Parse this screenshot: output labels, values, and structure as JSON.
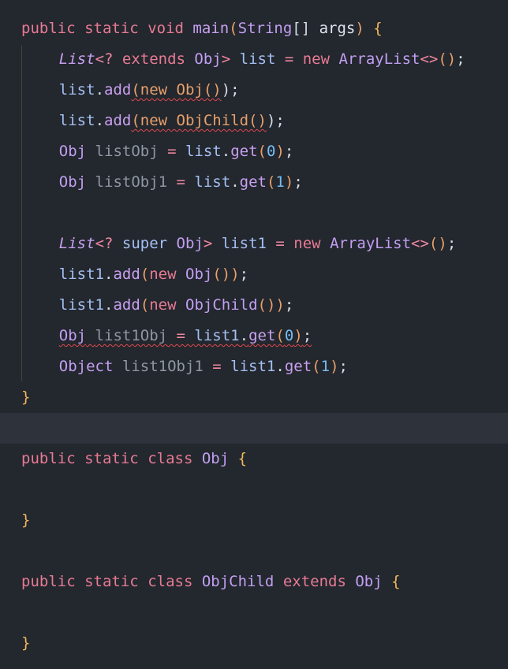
{
  "lines": [
    {
      "id": "main-signature",
      "indent": 0,
      "tokens": [
        {
          "t": "public",
          "c": "kw"
        },
        {
          "t": " ",
          "c": "pun"
        },
        {
          "t": "static",
          "c": "kw"
        },
        {
          "t": " ",
          "c": "pun"
        },
        {
          "t": "void",
          "c": "kw"
        },
        {
          "t": " ",
          "c": "pun"
        },
        {
          "t": "main",
          "c": "fn"
        },
        {
          "t": "(",
          "c": "par"
        },
        {
          "t": "String",
          "c": "ty"
        },
        {
          "t": "[]",
          "c": "pun"
        },
        {
          "t": " ",
          "c": "pun"
        },
        {
          "t": "args",
          "c": "arg"
        },
        {
          "t": ")",
          "c": "par"
        },
        {
          "t": " ",
          "c": "pun"
        },
        {
          "t": "{",
          "c": "br"
        }
      ]
    },
    {
      "id": "extends-list-declaration",
      "indent": 4,
      "tokens": [
        {
          "t": "List",
          "c": "fni"
        },
        {
          "t": "<? ",
          "c": "op"
        },
        {
          "t": "extends",
          "c": "kw"
        },
        {
          "t": " ",
          "c": "pun"
        },
        {
          "t": "Obj",
          "c": "ty"
        },
        {
          "t": "> ",
          "c": "op"
        },
        {
          "t": "list",
          "c": "var"
        },
        {
          "t": " = ",
          "c": "op"
        },
        {
          "t": "new",
          "c": "kw"
        },
        {
          "t": " ",
          "c": "pun"
        },
        {
          "t": "ArrayList",
          "c": "ty"
        },
        {
          "t": "<>",
          "c": "op"
        },
        {
          "t": "()",
          "c": "par"
        },
        {
          "t": ";",
          "c": "pun"
        }
      ]
    },
    {
      "id": "list-add-obj",
      "indent": 4,
      "tokens": [
        {
          "t": "list",
          "c": "var"
        },
        {
          "t": ".",
          "c": "pun"
        },
        {
          "t": "add",
          "c": "fn"
        },
        {
          "t": "(new Obj()",
          "c": "par",
          "err": true
        },
        {
          "t": ");",
          "c": "pun"
        }
      ]
    },
    {
      "id": "list-add-objchild",
      "indent": 4,
      "tokens": [
        {
          "t": "list",
          "c": "var"
        },
        {
          "t": ".",
          "c": "pun"
        },
        {
          "t": "add",
          "c": "fn"
        },
        {
          "t": "(new ObjChild()",
          "c": "par",
          "err": true
        },
        {
          "t": ");",
          "c": "pun"
        }
      ]
    },
    {
      "id": "list-get-0",
      "indent": 4,
      "tokens": [
        {
          "t": "Obj",
          "c": "ty"
        },
        {
          "t": " ",
          "c": "pun"
        },
        {
          "t": "listObj",
          "c": "unused"
        },
        {
          "t": " = ",
          "c": "op"
        },
        {
          "t": "list",
          "c": "var"
        },
        {
          "t": ".",
          "c": "pun"
        },
        {
          "t": "get",
          "c": "fn"
        },
        {
          "t": "(",
          "c": "par"
        },
        {
          "t": "0",
          "c": "num"
        },
        {
          "t": ")",
          "c": "par"
        },
        {
          "t": ";",
          "c": "pun"
        }
      ]
    },
    {
      "id": "list-get-1",
      "indent": 4,
      "tokens": [
        {
          "t": "Obj",
          "c": "ty"
        },
        {
          "t": " ",
          "c": "pun"
        },
        {
          "t": "listObj1",
          "c": "unused"
        },
        {
          "t": " = ",
          "c": "op"
        },
        {
          "t": "list",
          "c": "var"
        },
        {
          "t": ".",
          "c": "pun"
        },
        {
          "t": "get",
          "c": "fn"
        },
        {
          "t": "(",
          "c": "par"
        },
        {
          "t": "1",
          "c": "num"
        },
        {
          "t": ")",
          "c": "par"
        },
        {
          "t": ";",
          "c": "pun"
        }
      ]
    },
    {
      "id": "blank-1",
      "indent": 0,
      "tokens": []
    },
    {
      "id": "super-list-declaration",
      "indent": 4,
      "tokens": [
        {
          "t": "List",
          "c": "fni"
        },
        {
          "t": "<? ",
          "c": "op"
        },
        {
          "t": "super",
          "c": "var"
        },
        {
          "t": " ",
          "c": "pun"
        },
        {
          "t": "Obj",
          "c": "ty"
        },
        {
          "t": "> ",
          "c": "op"
        },
        {
          "t": "list1",
          "c": "var"
        },
        {
          "t": " = ",
          "c": "op"
        },
        {
          "t": "new",
          "c": "kw"
        },
        {
          "t": " ",
          "c": "pun"
        },
        {
          "t": "ArrayList",
          "c": "ty"
        },
        {
          "t": "<>",
          "c": "op"
        },
        {
          "t": "()",
          "c": "par"
        },
        {
          "t": ";",
          "c": "pun"
        }
      ]
    },
    {
      "id": "list1-add-obj",
      "indent": 4,
      "tokens": [
        {
          "t": "list1",
          "c": "var"
        },
        {
          "t": ".",
          "c": "pun"
        },
        {
          "t": "add",
          "c": "fn"
        },
        {
          "t": "(",
          "c": "par"
        },
        {
          "t": "new",
          "c": "kw"
        },
        {
          "t": " ",
          "c": "pun"
        },
        {
          "t": "Obj",
          "c": "ty"
        },
        {
          "t": "())",
          "c": "par"
        },
        {
          "t": ";",
          "c": "pun"
        }
      ]
    },
    {
      "id": "list1-add-objchild",
      "indent": 4,
      "tokens": [
        {
          "t": "list1",
          "c": "var"
        },
        {
          "t": ".",
          "c": "pun"
        },
        {
          "t": "add",
          "c": "fn"
        },
        {
          "t": "(",
          "c": "par"
        },
        {
          "t": "new",
          "c": "kw"
        },
        {
          "t": " ",
          "c": "pun"
        },
        {
          "t": "ObjChild",
          "c": "ty"
        },
        {
          "t": "())",
          "c": "par"
        },
        {
          "t": ";",
          "c": "pun"
        }
      ]
    },
    {
      "id": "list1-get-0",
      "indent": 4,
      "tokens": [
        {
          "t": "Obj",
          "c": "ty",
          "err": true
        },
        {
          "t": " ",
          "c": "pun",
          "err": true
        },
        {
          "t": "list1Obj",
          "c": "unused",
          "err": true
        },
        {
          "t": " = ",
          "c": "op",
          "err": true
        },
        {
          "t": "list1",
          "c": "var",
          "err": true
        },
        {
          "t": ".",
          "c": "pun",
          "err": true
        },
        {
          "t": "get",
          "c": "fn",
          "err": true
        },
        {
          "t": "(",
          "c": "par",
          "err": true
        },
        {
          "t": "0",
          "c": "num",
          "err": true
        },
        {
          "t": ")",
          "c": "par",
          "err": true
        },
        {
          "t": ";",
          "c": "pun",
          "err": true
        }
      ]
    },
    {
      "id": "list1-get-1",
      "indent": 4,
      "tokens": [
        {
          "t": "Object",
          "c": "ty"
        },
        {
          "t": " ",
          "c": "pun"
        },
        {
          "t": "list1Obj1",
          "c": "unused"
        },
        {
          "t": " = ",
          "c": "op"
        },
        {
          "t": "list1",
          "c": "var"
        },
        {
          "t": ".",
          "c": "pun"
        },
        {
          "t": "get",
          "c": "fn"
        },
        {
          "t": "(",
          "c": "par"
        },
        {
          "t": "1",
          "c": "num"
        },
        {
          "t": ")",
          "c": "par"
        },
        {
          "t": ";",
          "c": "pun"
        }
      ]
    },
    {
      "id": "main-close",
      "indent": 0,
      "tokens": [
        {
          "t": "}",
          "c": "br"
        }
      ]
    },
    {
      "id": "blank-current",
      "indent": 0,
      "current": true,
      "tokens": []
    },
    {
      "id": "class-obj-declaration",
      "indent": 0,
      "tokens": [
        {
          "t": "public",
          "c": "kw"
        },
        {
          "t": " ",
          "c": "pun"
        },
        {
          "t": "static",
          "c": "kw"
        },
        {
          "t": " ",
          "c": "pun"
        },
        {
          "t": "class",
          "c": "kw"
        },
        {
          "t": " ",
          "c": "pun"
        },
        {
          "t": "Obj",
          "c": "ty"
        },
        {
          "t": " ",
          "c": "pun"
        },
        {
          "t": "{",
          "c": "br"
        }
      ]
    },
    {
      "id": "blank-2",
      "indent": 0,
      "tokens": []
    },
    {
      "id": "class-obj-close",
      "indent": 0,
      "tokens": [
        {
          "t": "}",
          "c": "br"
        }
      ]
    },
    {
      "id": "blank-3",
      "indent": 0,
      "tokens": []
    },
    {
      "id": "class-objchild-declaration",
      "indent": 0,
      "tokens": [
        {
          "t": "public",
          "c": "kw"
        },
        {
          "t": " ",
          "c": "pun"
        },
        {
          "t": "static",
          "c": "kw"
        },
        {
          "t": " ",
          "c": "pun"
        },
        {
          "t": "class",
          "c": "kw"
        },
        {
          "t": " ",
          "c": "pun"
        },
        {
          "t": "ObjChild",
          "c": "ty"
        },
        {
          "t": " ",
          "c": "pun"
        },
        {
          "t": "extends",
          "c": "kw"
        },
        {
          "t": " ",
          "c": "pun"
        },
        {
          "t": "Obj",
          "c": "ty"
        },
        {
          "t": " ",
          "c": "pun"
        },
        {
          "t": "{",
          "c": "br"
        }
      ]
    },
    {
      "id": "blank-4",
      "indent": 0,
      "tokens": []
    },
    {
      "id": "class-objchild-close",
      "indent": 0,
      "tokens": [
        {
          "t": "}",
          "c": "br"
        }
      ]
    }
  ]
}
